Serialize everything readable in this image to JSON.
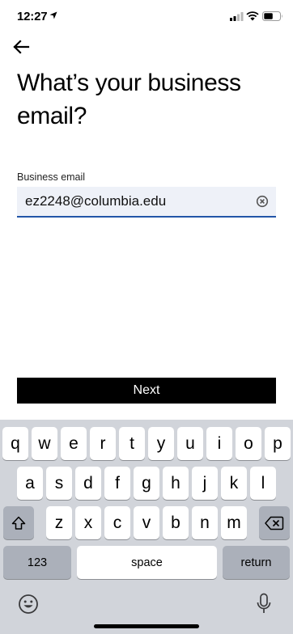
{
  "status_bar": {
    "time": "12:27"
  },
  "header": {
    "title": "What’s your business email?"
  },
  "form": {
    "label": "Business email",
    "value": "ez2248@columbia.edu"
  },
  "actions": {
    "next_label": "Next"
  },
  "keyboard": {
    "row1": [
      "q",
      "w",
      "e",
      "r",
      "t",
      "y",
      "u",
      "i",
      "o",
      "p"
    ],
    "row2": [
      "a",
      "s",
      "d",
      "f",
      "g",
      "h",
      "j",
      "k",
      "l"
    ],
    "row3": [
      "z",
      "x",
      "c",
      "v",
      "b",
      "n",
      "m"
    ],
    "numbers_label": "123",
    "space_label": "space",
    "return_label": "return"
  },
  "icons": {
    "status": [
      "location-arrow-icon",
      "cellular-signal-icon",
      "wifi-icon",
      "battery-icon"
    ],
    "header": "back-arrow-icon",
    "field": "clear-icon",
    "keyboard": [
      "shift-icon",
      "backspace-icon",
      "emoji-icon",
      "microphone-icon"
    ]
  }
}
